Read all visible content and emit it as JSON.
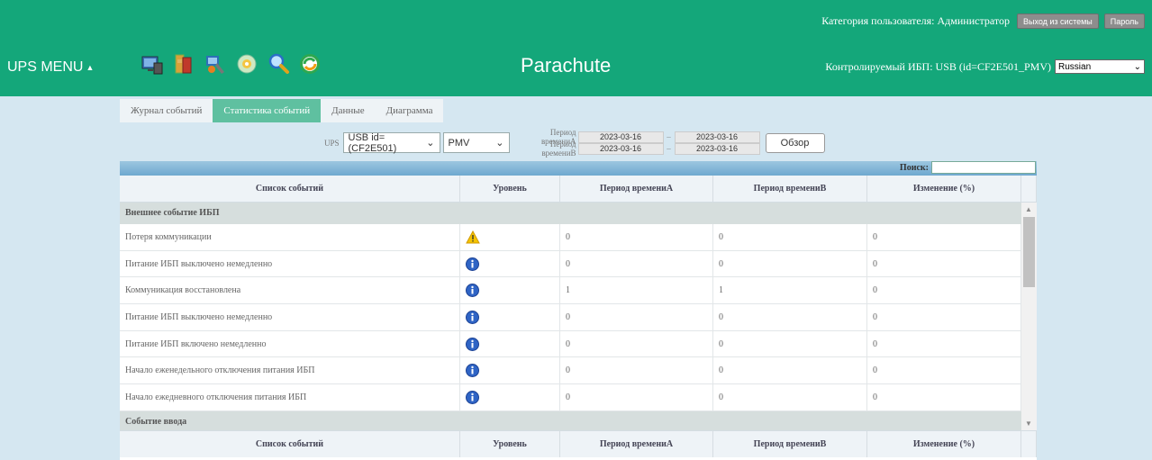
{
  "header": {
    "user_category": "Категория пользователя: Администратор",
    "logout_label": "Выход из системы",
    "password_label": "Пароль",
    "menu_label": "UPS MENU",
    "brand": "Parachute",
    "monitored_ups": "Контролируемый ИБП: USB (id=CF2E501_PMV)",
    "language": "Russian",
    "toolbar_icons": [
      "monitor-icon",
      "battery-icon",
      "settings-tools-icon",
      "disc-icon",
      "search-icon",
      "refresh-icon"
    ]
  },
  "tabs": [
    {
      "label": "Журнал событий",
      "active": false
    },
    {
      "label": "Статистика событий",
      "active": true
    },
    {
      "label": "Данные",
      "active": false
    },
    {
      "label": "Диаграмма",
      "active": false
    }
  ],
  "filter": {
    "ups_label": "UPS",
    "ups_value": "USB id=(CF2E501)",
    "model_value": "PMV",
    "period_a_label": "Период времениA",
    "period_b_label": "Период времениB",
    "period_a_from": "2023-03-16",
    "period_a_to": "2023-03-16",
    "period_b_from": "2023-03-16",
    "period_b_to": "2023-03-16",
    "dash": "–",
    "browse_label": "Обзор"
  },
  "table": {
    "search_label": "Поиск:",
    "columns": [
      "Список событий",
      "Уровень",
      "Период времениA",
      "Период времениB",
      "Изменение (%)"
    ],
    "sections": [
      {
        "title": "Внешнее событие ИБП",
        "rows": [
          {
            "event": "Потеря коммуникации",
            "level": "warning",
            "a": "0",
            "b": "0",
            "change": "0"
          },
          {
            "event": "Питание ИБП выключено немедленно",
            "level": "info",
            "a": "0",
            "b": "0",
            "change": "0"
          },
          {
            "event": "Коммуникация восстановлена",
            "level": "info",
            "a": "1",
            "b": "1",
            "change": "0"
          },
          {
            "event": "Питание ИБП выключено немедленно",
            "level": "info",
            "a": "0",
            "b": "0",
            "change": "0"
          },
          {
            "event": "Питание ИБП включено немедленно",
            "level": "info",
            "a": "0",
            "b": "0",
            "change": "0"
          },
          {
            "event": "Начало еженедельного отключения питания ИБП",
            "level": "info",
            "a": "0",
            "b": "0",
            "change": "0"
          },
          {
            "event": "Начало ежедневного отключения питания ИБП",
            "level": "info",
            "a": "0",
            "b": "0",
            "change": "0"
          }
        ]
      },
      {
        "title": "Событие ввода",
        "rows": []
      }
    ]
  }
}
